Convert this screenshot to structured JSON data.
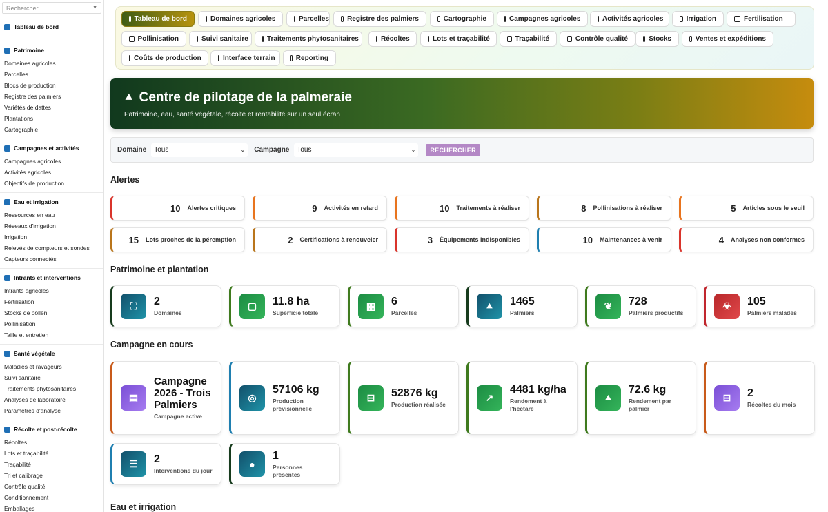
{
  "sidebar": {
    "search_placeholder": "Rechercher",
    "dashboard": "Tableau de bord",
    "groups": [
      {
        "title": "Patrimoine",
        "items": [
          "Domaines agricoles",
          "Parcelles",
          "Blocs de production",
          "Registre des palmiers",
          "Variétés de dattes",
          "Plantations",
          "Cartographie"
        ]
      },
      {
        "title": "Campagnes et activités",
        "items": [
          "Campagnes agricoles",
          "Activités agricoles",
          "Objectifs de production"
        ]
      },
      {
        "title": "Eau et irrigation",
        "items": [
          "Ressources en eau",
          "Réseaux d'irrigation",
          "Irrigation",
          "Relevés de compteurs et sondes",
          "Capteurs connectés"
        ]
      },
      {
        "title": "Intrants et interventions",
        "items": [
          "Intrants agricoles",
          "Fertilisation",
          "Stocks de pollen",
          "Pollinisation",
          "Taille et entretien"
        ]
      },
      {
        "title": "Santé végétale",
        "items": [
          "Maladies et ravageurs",
          "Suivi sanitaire",
          "Traitements phytosanitaires",
          "Analyses de laboratoire",
          "Paramètres d'analyse"
        ]
      },
      {
        "title": "Récolte et post-récolte",
        "items": [
          "Récoltes",
          "Lots et traçabilité",
          "Traçabilité",
          "Tri et calibrage",
          "Contrôle qualité",
          "Conditionnement",
          "Emballages"
        ]
      }
    ]
  },
  "nav": [
    "Tableau de bord",
    "Domaines agricoles",
    "Parcelles",
    "Registre des palmiers",
    "Cartographie",
    "Campagnes agricoles",
    "Activités agricoles",
    "Irrigation",
    "Fertilisation",
    "Pollinisation",
    "Suivi sanitaire",
    "Traitements phytosanitaires",
    "Récoltes",
    "Lots et traçabilité",
    "Traçabilité",
    "Contrôle qualité",
    "Stocks",
    "Ventes et expéditions",
    "Coûts de production",
    "Interface terrain",
    "Reporting"
  ],
  "hero": {
    "title": "Centre de pilotage de la palmeraie",
    "subtitle": "Patrimoine, eau, santé végétale, récolte et rentabilité sur un seul écran"
  },
  "filter": {
    "domain_label": "Domaine",
    "domain_value": "Tous",
    "campaign_label": "Campagne",
    "campaign_value": "Tous",
    "search_button": "RECHERCHER"
  },
  "sections": {
    "alerts": "Alertes",
    "patrimoine": "Patrimoine et plantation",
    "campagne": "Campagne en cours",
    "eau": "Eau et irrigation"
  },
  "alerts": [
    {
      "n": "10",
      "label": "Alertes critiques",
      "color": "#d9342b"
    },
    {
      "n": "9",
      "label": "Activités en retard",
      "color": "#e8741e"
    },
    {
      "n": "10",
      "label": "Traitements à réaliser",
      "color": "#e8741e"
    },
    {
      "n": "8",
      "label": "Pollinisations à réaliser",
      "color": "#b9751b"
    },
    {
      "n": "5",
      "label": "Articles sous le seuil",
      "color": "#e8741e"
    },
    {
      "n": "15",
      "label": "Lots proches de la péremption",
      "color": "#b9751b"
    },
    {
      "n": "2",
      "label": "Certifications à renouveler",
      "color": "#b9751b"
    },
    {
      "n": "3",
      "label": "Équipements indisponibles",
      "color": "#d9342b"
    },
    {
      "n": "10",
      "label": "Maintenances à venir",
      "color": "#1f7fb0"
    },
    {
      "n": "4",
      "label": "Analyses non conformes",
      "color": "#d9342b"
    }
  ],
  "patrimoine": [
    {
      "v": "2",
      "l": "Domaines",
      "icon": "map-icon",
      "c1": "#12506b",
      "c2": "#1f93a8",
      "border": "#173b1d"
    },
    {
      "v": "11.8 ha",
      "l": "Superficie totale",
      "icon": "area-icon",
      "c1": "#1c8c43",
      "c2": "#34b45a",
      "border": "#3f7a1e"
    },
    {
      "v": "6",
      "l": "Parcelles",
      "icon": "grid-icon",
      "c1": "#1c8c43",
      "c2": "#34b45a",
      "border": "#3f7a1e"
    },
    {
      "v": "1465",
      "l": "Palmiers",
      "icon": "tree-icon",
      "c1": "#12506b",
      "c2": "#1f93a8",
      "border": "#173b1d"
    },
    {
      "v": "728",
      "l": "Palmiers productifs",
      "icon": "sprout-icon",
      "c1": "#1c8c43",
      "c2": "#34b45a",
      "border": "#3f7a1e"
    },
    {
      "v": "105",
      "l": "Palmiers malades",
      "icon": "biohazard-icon",
      "c1": "#b8272a",
      "c2": "#e0484a",
      "border": "#c0262d"
    }
  ],
  "campagne": [
    {
      "v": "Campagne 2026 - Trois Palmiers",
      "l": "Campagne active",
      "icon": "calendar-icon",
      "c1": "#7b4fd6",
      "c2": "#a67cf0",
      "border": "#c85a1a"
    },
    {
      "v": "57106 kg",
      "l": "Production prévisionnelle",
      "icon": "target-icon",
      "c1": "#12506b",
      "c2": "#1f93a8",
      "border": "#1f7fb0"
    },
    {
      "v": "52876 kg",
      "l": "Production réalisée",
      "icon": "basket-icon",
      "c1": "#1c8c43",
      "c2": "#34b45a",
      "border": "#3f7a1e"
    },
    {
      "v": "4481 kg/ha",
      "l": "Rendement à l'hectare",
      "icon": "trend-icon",
      "c1": "#1c8c43",
      "c2": "#34b45a",
      "border": "#3f7a1e"
    },
    {
      "v": "72.6 kg",
      "l": "Rendement par palmier",
      "icon": "tree-icon",
      "c1": "#1c8c43",
      "c2": "#34b45a",
      "border": "#3f7a1e"
    },
    {
      "v": "2",
      "l": "Récoltes du mois",
      "icon": "basket-icon",
      "c1": "#7b4fd6",
      "c2": "#a67cf0",
      "border": "#c85a1a"
    },
    {
      "v": "2",
      "l": "Interventions du jour",
      "icon": "checklist-icon",
      "c1": "#12506b",
      "c2": "#1f93a8",
      "border": "#1f7fb0"
    },
    {
      "v": "1",
      "l": "Personnes présentes",
      "icon": "users-icon",
      "c1": "#12506b",
      "c2": "#1f93a8",
      "border": "#173b1d"
    }
  ]
}
